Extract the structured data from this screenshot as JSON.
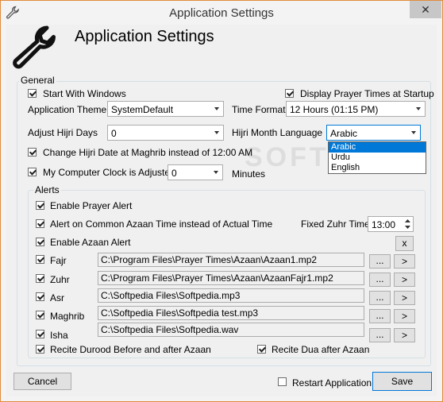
{
  "window": {
    "title": "Application Settings",
    "close_glyph": "✕",
    "header_title": "Application Settings"
  },
  "general": {
    "group_label": "General",
    "start_with_windows": {
      "label": "Start With Windows",
      "checked": true
    },
    "display_prayer_times": {
      "label": "Display Prayer Times at Startup",
      "checked": true
    },
    "application_theme": {
      "label": "Application Theme",
      "value": "SystemDefault"
    },
    "time_format": {
      "label": "Time Format",
      "value": "12 Hours (01:15 PM)"
    },
    "adjust_hijri_days": {
      "label": "Adjust Hijri Days",
      "value": "0"
    },
    "hijri_month_language": {
      "label": "Hijri Month Language",
      "value": "Arabic",
      "options": [
        "Arabic",
        "Urdu",
        "English"
      ]
    },
    "change_hijri_date": {
      "label": "Change Hijri Date at Maghrib instead of 12:00 AM",
      "checked": true
    },
    "computer_clock": {
      "label": "My Computer Clock is Adjusted",
      "checked": true,
      "value": "0",
      "unit": "Minutes"
    }
  },
  "alerts": {
    "group_label": "Alerts",
    "enable_prayer_alert": {
      "label": "Enable Prayer Alert",
      "checked": true
    },
    "common_azaan_time": {
      "label": "Alert on Common Azaan Time instead of Actual Time",
      "checked": true
    },
    "fixed_zuhr_time": {
      "label": "Fixed Zuhr Time",
      "value": "13:00"
    },
    "enable_azaan_alert": {
      "label": "Enable Azaan Alert",
      "checked": true
    },
    "clear_button": "x",
    "browse_button": "...",
    "play_button": ">",
    "prayers": [
      {
        "name": "Fajr",
        "checked": true,
        "path": "C:\\Program Files\\Prayer Times\\Azaan\\Azaan1.mp2"
      },
      {
        "name": "Zuhr",
        "checked": true,
        "path": "C:\\Program Files\\Prayer Times\\Azaan\\AzaanFajr1.mp2"
      },
      {
        "name": "Asr",
        "checked": true,
        "path": "C:\\Softpedia Files\\Softpedia.mp3"
      },
      {
        "name": "Maghrib",
        "checked": true,
        "path": "C:\\Softpedia Files\\Softpedia test.mp3"
      },
      {
        "name": "Isha",
        "checked": true,
        "path": "C:\\Softpedia Files\\Softpedia.wav"
      }
    ],
    "recite_durood": {
      "label": "Recite Durood Before and after Azaan",
      "checked": true
    },
    "recite_dua": {
      "label": "Recite Dua after Azaan",
      "checked": true
    }
  },
  "footer": {
    "cancel_label": "Cancel",
    "restart_label": "Restart Application",
    "restart_checked": false,
    "save_label": "Save"
  },
  "watermark": "SOFTPEDIA"
}
